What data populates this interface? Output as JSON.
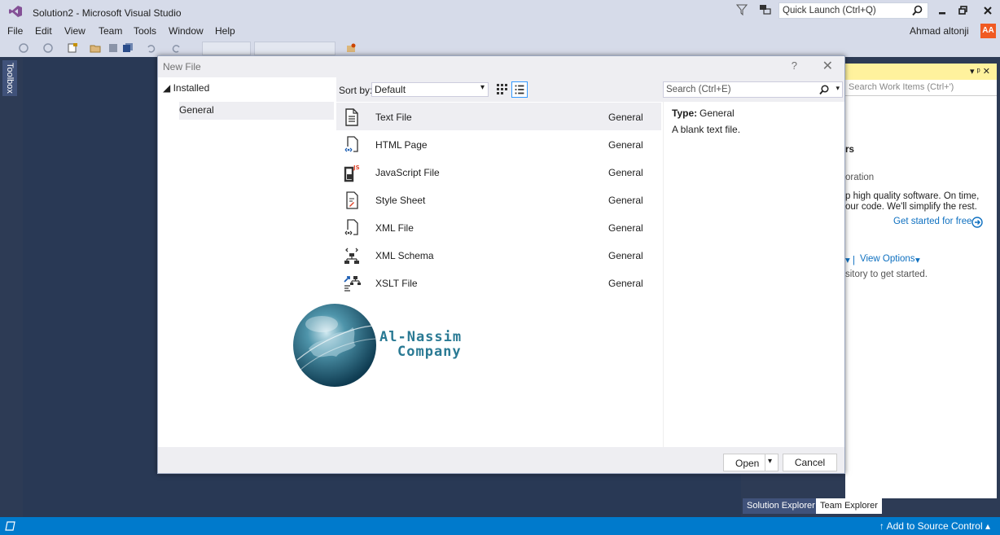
{
  "window": {
    "title": "Solution2 - Microsoft Visual Studio",
    "quick_launch_placeholder": "Quick Launch (Ctrl+Q)"
  },
  "menu": [
    "File",
    "Edit",
    "View",
    "Team",
    "Tools",
    "Window",
    "Help"
  ],
  "account": {
    "name": "Ahmad altonji",
    "initials": "AA",
    "avatar_color": "#f05a22"
  },
  "toolbox": {
    "label": "Toolbox"
  },
  "dialog": {
    "title": "New File",
    "help_glyph": "?",
    "close_glyph": "✕",
    "tree": {
      "root": "Installed",
      "selected": "General"
    },
    "sort": {
      "label": "Sort by:",
      "value": "Default"
    },
    "search_placeholder": "Search (Ctrl+E)",
    "items": [
      {
        "name": "Text File",
        "category": "General",
        "icon": "text-file-icon",
        "selected": true
      },
      {
        "name": "HTML Page",
        "category": "General",
        "icon": "html-page-icon",
        "selected": false
      },
      {
        "name": "JavaScript File",
        "category": "General",
        "icon": "javascript-file-icon",
        "selected": false
      },
      {
        "name": "Style Sheet",
        "category": "General",
        "icon": "style-sheet-icon",
        "selected": false
      },
      {
        "name": "XML File",
        "category": "General",
        "icon": "xml-file-icon",
        "selected": false
      },
      {
        "name": "XML Schema",
        "category": "General",
        "icon": "xml-schema-icon",
        "selected": false
      },
      {
        "name": "XSLT File",
        "category": "General",
        "icon": "xslt-file-icon",
        "selected": false
      }
    ],
    "details": {
      "type_label": "Type:",
      "type_value": "General",
      "description": "A blank text file."
    },
    "buttons": {
      "open": "Open",
      "cancel": "Cancel"
    }
  },
  "team_explorer": {
    "search_placeholder": "Search Work Items (Ctrl+')",
    "text_rs": "rs",
    "text_oration": "oration",
    "line1": "p high quality software. On time,",
    "line2": "our code. We'll simplify the rest.",
    "get_started": "Get started for free",
    "view_options": "View Options",
    "repo_text": "sitory to get started.",
    "pin_glyphs": "▾ ᵖ ✕",
    "tabs": [
      "Solution Explorer",
      "Team Explorer"
    ],
    "accent": "#fff29d"
  },
  "status": {
    "source_control": "Add to Source Control",
    "color": "#007acc"
  },
  "watermark": {
    "line1": "Al-Nassim",
    "line2": "Company"
  }
}
